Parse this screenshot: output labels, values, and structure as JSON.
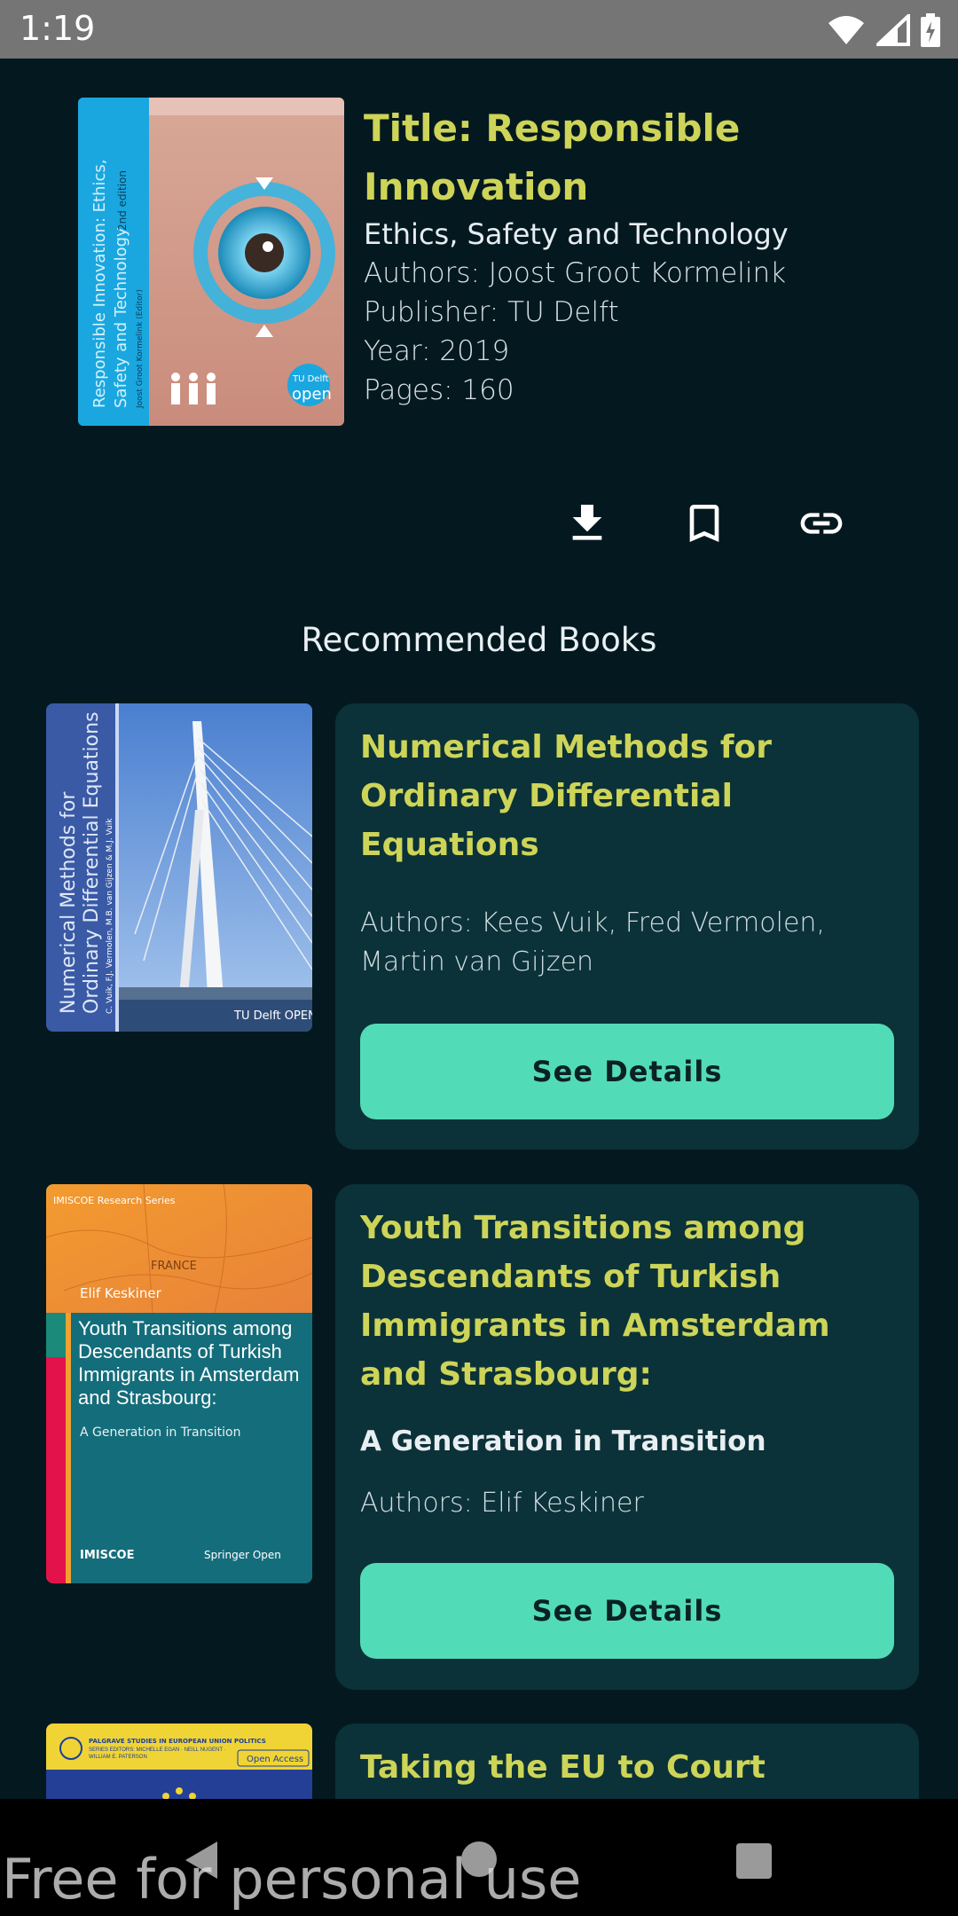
{
  "status": {
    "time": "1:19"
  },
  "book": {
    "title": "Title: Responsible Innovation",
    "subtitle": "Ethics, Safety and Technology",
    "authors": "Authors: Joost Groot Kormelink",
    "publisher": "Publisher: TU Delft",
    "year": "Year: 2019",
    "pages": "Pages: 160",
    "cover": {
      "text1": "Responsible Innovation: Ethics,",
      "text2": "Safety and Technology",
      "edition": "2nd edition",
      "editor": "Joost Groot Kormelink (Editor)",
      "badge1": "TU Delft",
      "badge2": "open"
    }
  },
  "actions": {
    "download_icon": "download-icon",
    "bookmark_icon": "bookmark-icon",
    "link_icon": "link-icon"
  },
  "section": {
    "title": "Recommended Books"
  },
  "recommended": [
    {
      "title": "Numerical Methods for Ordinary Differential Equations",
      "authors": "Authors: Kees Vuik, Fred Vermolen, Martin van Gijzen",
      "button": "See Details",
      "cover": {
        "line1": "Numerical Methods for",
        "line2": "Ordinary Differential Equations",
        "authors": "C. Vuik, F.J. Vermolen, M.B. van Gijzen & M.J. Vuik",
        "publisher": "TU Delft OPEN"
      }
    },
    {
      "title": "Youth Transitions among Descendants of Turkish Immigrants in Amsterdam and Strasbourg:",
      "subtitle": "A Generation in Transition",
      "authors": "Authors: Elif Keskiner",
      "button": "See Details",
      "cover": {
        "series": "IMISCOE Research Series",
        "author": "Elif Keskiner",
        "map_label": "FRANCE",
        "title": "Youth Transitions among Descendants of Turkish Immigrants in Amsterdam and Strasbourg:",
        "subtitle": "A Generation in Transition",
        "imprint_left": "IMISCOE",
        "imprint_right": "Springer Open"
      }
    },
    {
      "title": "Taking the EU to Court",
      "cover": {
        "series": "PALGRAVE STUDIES IN EUROPEAN UNION POLITICS",
        "editors": "SERIES EDITORS: MICHELLE EGAN · NEILL NUGENT · WILLIAM E. PATERSON",
        "badge": "Open Access"
      }
    }
  ],
  "watermark": "Free for personal use",
  "colors": {
    "background": "#04191f",
    "accent_title": "#cdd458",
    "button": "#52dbb7",
    "card": "#0b3238"
  }
}
